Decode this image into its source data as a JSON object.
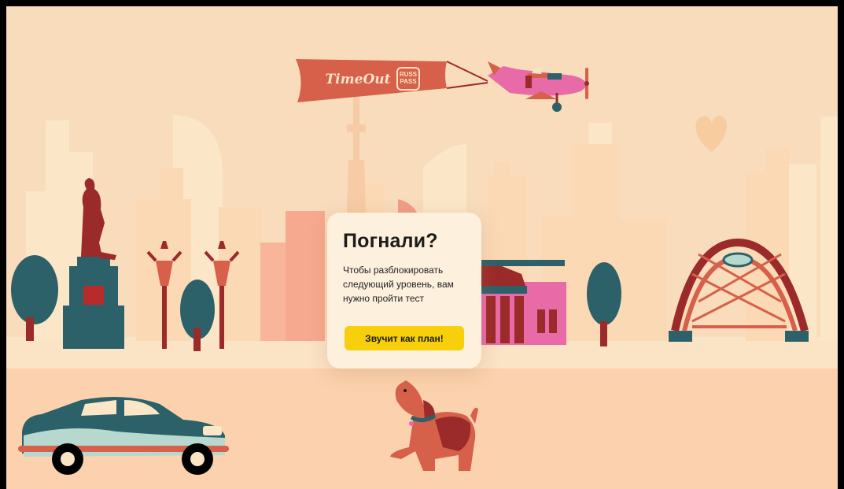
{
  "banner": {
    "brand_left": "TimeOut",
    "brand_right_line1": "RUSS",
    "brand_right_line2": "PASS"
  },
  "dialog": {
    "title": "Погнали?",
    "description": "Чтобы разблокировать следующий уровень, вам нужно пройти тест",
    "button_label": "Звучит как план!"
  },
  "colors": {
    "background": "#f8dcbc",
    "ground": "#fbd2ad",
    "button": "#f7cf0a",
    "card": "#fdf0dc",
    "teal": "#2d6169",
    "brick": "#d6604a",
    "pink": "#e86aa6"
  }
}
